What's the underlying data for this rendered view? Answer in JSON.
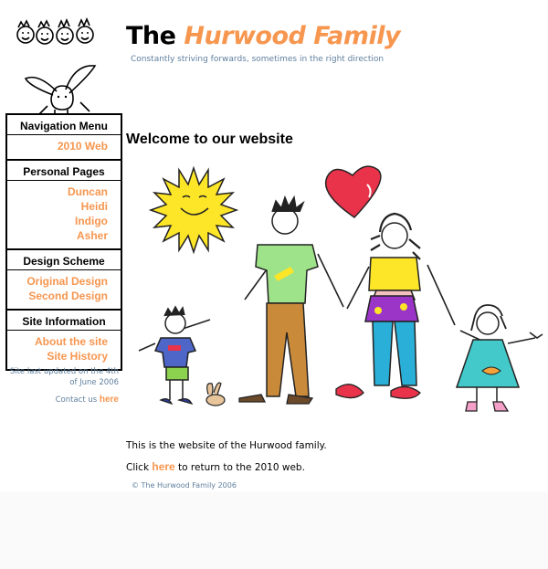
{
  "header": {
    "title_prefix": "The ",
    "title_name": "Hurwood Family",
    "tagline": "Constantly striving forwards, sometimes in the right direction"
  },
  "nav": {
    "sections": [
      {
        "heading": "Navigation Menu",
        "links": [
          "2010 Web"
        ]
      },
      {
        "heading": "Personal Pages",
        "links": [
          "Duncan",
          "Heidi",
          "Indigo",
          "Asher"
        ]
      },
      {
        "heading": "Design Scheme",
        "links": [
          "Original Design",
          "Second Design"
        ]
      },
      {
        "heading": "Site Information",
        "links": [
          "About the site",
          "Site History"
        ]
      }
    ]
  },
  "sidebar": {
    "updated": "Site last updated on the 4th of June 2006",
    "contact_prefix": "Contact us ",
    "contact_link": "here"
  },
  "main": {
    "welcome": "Welcome to our website",
    "intro": "This is the website of the Hurwood family.",
    "click_prefix": "Click ",
    "click_link": "here",
    "click_suffix": " to return to the 2010 web.",
    "copyright": "© The Hurwood Family 2006"
  },
  "colors": {
    "accent": "#f7964f",
    "muted": "#5f7f9f"
  }
}
